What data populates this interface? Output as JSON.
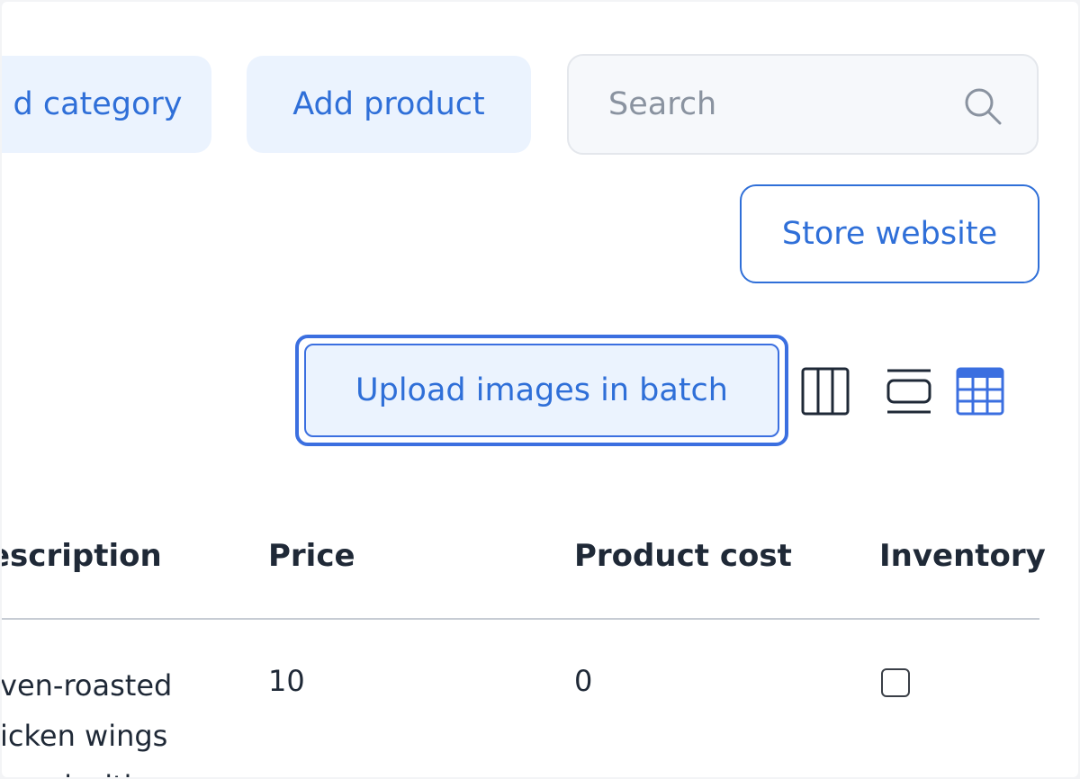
{
  "toolbar": {
    "add_category_label": "d category",
    "add_product_label": "Add product",
    "search_placeholder": "Search",
    "store_website_label": "Store website",
    "upload_images_label": "Upload images in batch"
  },
  "view_modes": [
    {
      "icon": "columns-view-icon",
      "active": false
    },
    {
      "icon": "row-view-icon",
      "active": false
    },
    {
      "icon": "grid-view-icon",
      "active": true
    }
  ],
  "colors": {
    "accent": "#2f6fd8",
    "button_bg": "#ebf3fe",
    "focus_ring": "#3b6fe0",
    "header_text": "#1f2937"
  },
  "table": {
    "columns": [
      "escription",
      "Price",
      "Product cost",
      "Inventory"
    ],
    "rows": [
      {
        "description": "ven-roasted\nicken wings\noped with",
        "price": "10",
        "product_cost": "0",
        "inventory_checked": false
      }
    ]
  }
}
